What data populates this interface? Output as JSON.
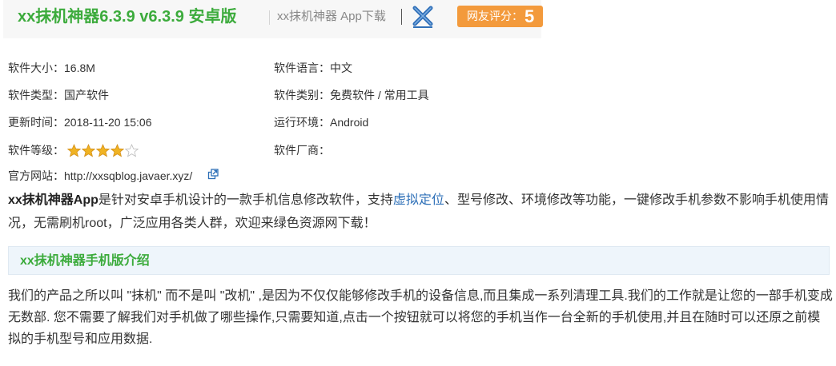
{
  "header": {
    "title": "xx抹机神器6.3.9 v6.3.9 安卓版",
    "subtitle": "xx抹机神器 App下载",
    "rating_label": "网友评分：",
    "rating_value": "5"
  },
  "info": {
    "size_label": "软件大小：",
    "size_value": "16.8M",
    "language_label": "软件语言：",
    "language_value": "中文",
    "type_label": "软件类型：",
    "type_value": "国产软件",
    "category_label": "软件类别：",
    "category_value": "免费软件 / 常用工具",
    "updated_label": "更新时间：",
    "updated_value": "2018-11-20 15:06",
    "env_label": "运行环境：",
    "env_value": "Android",
    "level_label": "软件等级：",
    "level_stars": 4,
    "level_max": 5,
    "vendor_label": "软件厂商：",
    "site_label": "官方网站：",
    "site_value": "http://xxsqblog.javaer.xyz/"
  },
  "description": {
    "bold_name": "xx抹机神器App",
    "text_before_link": "是针对安卓手机设计的一款手机信息修改软件，支持",
    "link_text": "虚拟定位",
    "text_after_link": "、型号修改、环境修改等功能，一键修改手机参数不影响手机使用情况，无需刷机root，广泛应用各类人群，欢迎来绿色资源网下载！"
  },
  "section": {
    "title": "xx抹机神器手机版介绍"
  },
  "intro_text": "我们的产品之所以叫 \"抹机\" 而不是叫 \"改机\" ,是因为不仅仅能够修改手机的设备信息,而且集成一系列清理工具.我们的工作就是让您的一部手机变成无数部. 您不需要了解我们对手机做了哪些操作,只需要知道,点击一个按钮就可以将您的手机当作一台全新的手机使用,并且在随时可以还原之前模拟的手机型号和应用数据.",
  "colors": {
    "title_green": "#3cab3c",
    "badge_orange": "#f39a3c",
    "link_blue": "#2d6fb7",
    "star_gold": "#f0b323",
    "section_bg": "#eef5fb"
  },
  "icons": {
    "header_icon": "x-icon",
    "star_icon": "star-icon",
    "external_link_icon": "external-link-icon"
  }
}
